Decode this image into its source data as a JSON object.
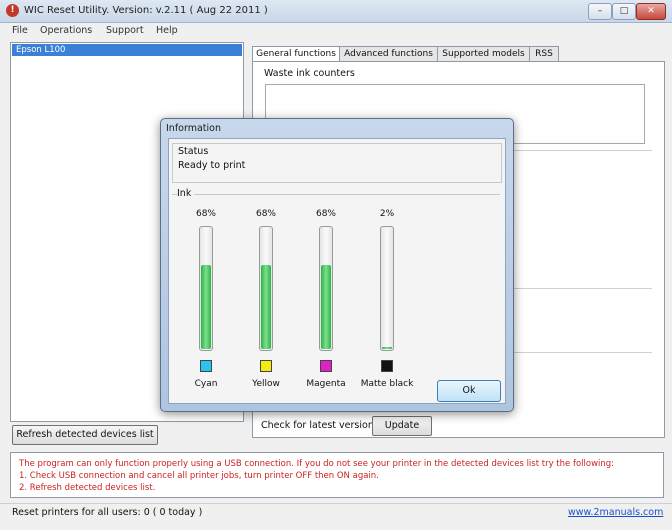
{
  "window": {
    "title": "WIC Reset Utility. Version: v.2.11 ( Aug 22 2011 )",
    "controls": {
      "minimize": "–",
      "maximize": "□",
      "close": "✕"
    }
  },
  "menu": [
    "File",
    "Operations",
    "Support",
    "Help"
  ],
  "devices": {
    "items": [
      "Epson L100"
    ],
    "refresh_label": "Refresh detected devices list"
  },
  "tabs": [
    "General functions",
    "Advanced functions",
    "Supported models",
    "RSS"
  ],
  "general": {
    "waste_label": "Waste ink counters",
    "check_label": "Check for latest version",
    "update_label": "Update"
  },
  "notice": [
    "The program can only function properly using a USB connection. If you do not see your printer in the detected devices list try the following:",
    "1. Check USB connection and cancel all printer jobs, turn printer OFF then ON again.",
    "2. Refresh detected devices list."
  ],
  "statusbar": {
    "text": "Reset printers for all users: 0 ( 0 today )",
    "link": "www.2manuals.com"
  },
  "dialog": {
    "title": "Information",
    "status_label": "Status",
    "status_value": "Ready to print",
    "ink_label": "Ink",
    "ok_label": "Ok",
    "inks": [
      {
        "name": "Cyan",
        "percent": "68%",
        "level": 0.68,
        "color": "#29c6ef"
      },
      {
        "name": "Yellow",
        "percent": "68%",
        "level": 0.68,
        "color": "#f2ea12"
      },
      {
        "name": "Magenta",
        "percent": "68%",
        "level": 0.68,
        "color": "#e020c8"
      },
      {
        "name": "Matte black",
        "percent": "2%",
        "level": 0.02,
        "color": "#111111"
      }
    ]
  },
  "colors": {
    "bar_fill": "#3cc25a",
    "notice_text": "#cc2222",
    "selection": "#3a80d6"
  }
}
